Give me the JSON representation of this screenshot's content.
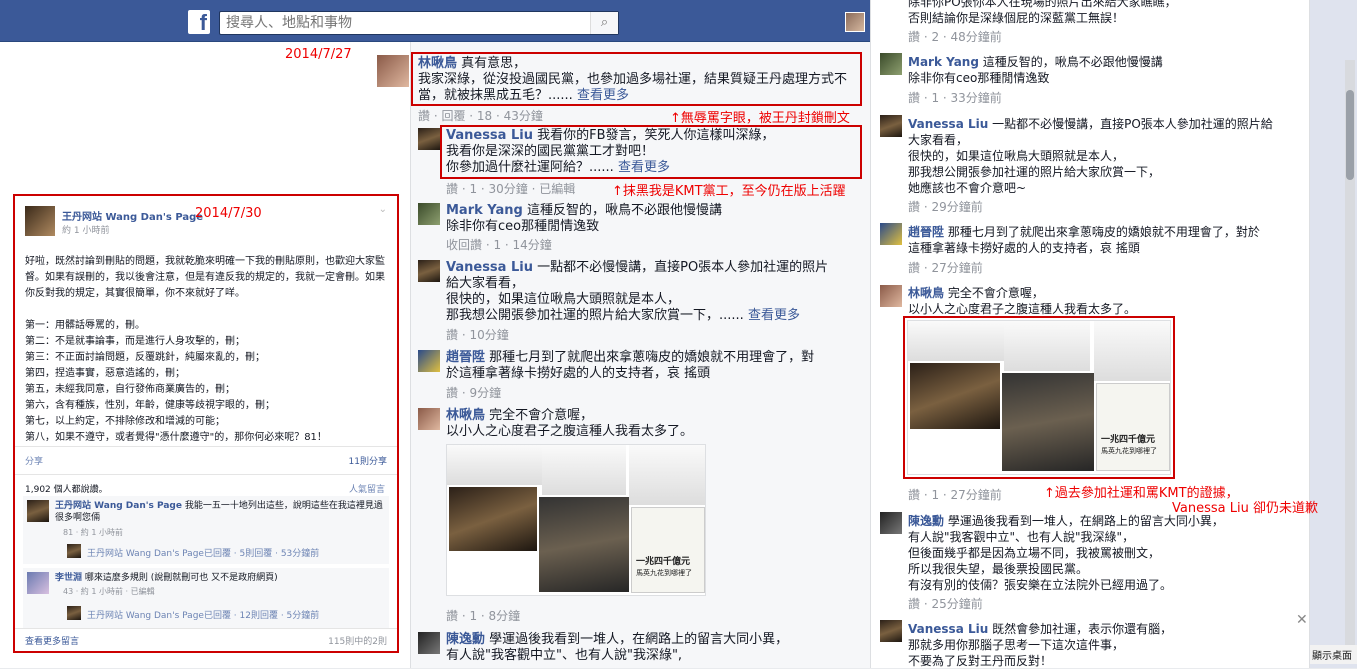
{
  "search": {
    "placeholder": "搜尋人、地點和事物"
  },
  "brand": {
    "logo": "f"
  },
  "dates": {
    "d1": "2014/7/27",
    "d2": "2014/7/30"
  },
  "wangdan_post": {
    "author": "王丹网站 Wang Dan's Page",
    "time": "約 1 小時前",
    "body": "好啦，既然討論到刪貼的問題，我就乾脆來明確一下我的刪貼原則，也歡迎大家監督。如果有誤刪的，我以後會注意，但是有違反我的規定的，我就一定會刪。如果你反對我的規定，其實很簡單，你不來就好了咩。\n\n第一：用髒話辱罵的，刪。\n第二：不是就事論事，而是進行人身攻擊的，刪；\n第三：不正面討論問題，反覆跳針，純屬來亂的，刪；\n第四，捏造事實，惡意造謠的，刪；\n第五，未經我同意，自行發佈商業廣告的，刪；\n第六，含有種族，性別，年齡，健康等歧視字眼的，刪；\n第七，以上約定，不排除修改和增減的可能；\n第八，如果不遵守，或者覺得\"憑什麼遵守\"的，那你何必來呢？81！",
    "share": "分享",
    "share_count": "11則分享",
    "likes": "1,902 個人都說讚。",
    "sort": "人氣留言",
    "comments": [
      {
        "name": "王丹网站 Wang Dan's Page",
        "text": "我能一五一十地列出這些，說明這些在我這裡見過很多啊您倆",
        "meta": "81 · 約 1 小時前",
        "reply": "王丹网站 Wang Dan's Page已回覆 · 5則回覆 · 53分鐘前"
      },
      {
        "name": "李世淵",
        "text": "哪來這麼多規則 (說刪就刪可也 又不是政府網頁)",
        "meta": "43 · 約 1 小時前 · 已編輯",
        "reply": "王丹网站 Wang Dan's Page已回覆 · 12則回覆 · 5分鐘前"
      }
    ],
    "more_comments": "查看更多留言",
    "count": "115則中的2則"
  },
  "middle": {
    "c1": {
      "name": "林啾鳥",
      "line1": "真有意思，",
      "line2": "我家深綠，從沒投過國民黨，也參加過多場社運，結果質疑王丹處理方式不",
      "line3": "當，就被抹黑成五毛？......",
      "more": "查看更多",
      "meta": "讚 · 回覆 · 18 · 43分鐘"
    },
    "anno1": "↑無辱罵字眼，被王丹封鎖刪文",
    "c2": {
      "name": "Vanessa Liu",
      "line1": "我看你的FB發言，笑死人你這樣叫深綠，",
      "line2": "我看你是深深的國民黨黨工才對吧！",
      "line3": "你參加過什麼社運阿給？......",
      "more": "查看更多",
      "meta": "讚 · 1 · 30分鐘 · 已編輯"
    },
    "anno2": "↑抹黑我是KMT黨工，至今仍在版上活躍",
    "c3": {
      "name": "Mark Yang",
      "line1": "這種反智的，啾鳥不必跟他慢慢講",
      "line2": "除非你有ceo那種閒情逸致",
      "meta": "收回讚 · 1 · 14分鐘"
    },
    "c4": {
      "name": "Vanessa Liu",
      "line1": "一點都不必慢慢講，直接PO張本人參加社運的照片",
      "line2": "給大家看看，",
      "line3": "很快的，如果這位啾鳥大頭照就是本人，",
      "line4": "那我想公開張參加社運的照片給大家欣賞一下，......",
      "more": "查看更多",
      "meta": "讚 · 10分鐘"
    },
    "c5": {
      "name": "趙晉陞",
      "line1": "那種七月到了就爬出來拿蔥嗨皮的嬌娘就不用理會了，對",
      "line2": "於這種拿著綠卡撈好處的人的支持者，哀 搖頭",
      "meta": "讚 · 9分鐘"
    },
    "c6": {
      "name": "林啾鳥",
      "line1": "完全不會介意喔，",
      "line2": "以小人之心度君子之腹這種人我看太多了。",
      "meta": "讚 · 1 · 8分鐘"
    },
    "c7": {
      "name": "陳逸勳",
      "line1": "學運過後我看到一堆人，在網路上的留言大同小異，",
      "line2": "有人說\"我客觀中立\"、也有人說\"我深綠\","
    }
  },
  "right": {
    "top1": "除非你PO張你本人在現場的照片出來給大家瞧瞧，",
    "top2": "否則結論你是深綠個屁的深藍黨工無誤！",
    "top_meta": "讚 · 2 · 48分鐘前",
    "r1": {
      "name": "Mark Yang",
      "line1": "這種反智的，啾鳥不必跟他慢慢講",
      "line2": "除非你有ceo那種閒情逸致",
      "meta": "讚 · 1 · 33分鐘前"
    },
    "r2": {
      "name": "Vanessa Liu",
      "line1": "一點都不必慢慢講，直接PO張本人參加社運的照片給",
      "line2": "大家看看，",
      "line3": "很快的，如果這位啾鳥大頭照就是本人，",
      "line4": "那我想公開張參加社運的照片給大家欣賞一下，",
      "line5": "她應該也不會介意吧~",
      "meta": "讚 · 29分鐘前"
    },
    "r3": {
      "name": "趙晉陞",
      "line1": "那種七月到了就爬出來拿蔥嗨皮的嬌娘就不用理會了，對於",
      "line2": "這種拿著綠卡撈好處的人的支持者，哀 搖頭",
      "meta": "讚 · 27分鐘前"
    },
    "r4": {
      "name": "林啾鳥",
      "line1": "完全不會介意喔，",
      "line2": "以小人之心度君子之腹這種人我看太多了。",
      "meta": "讚 · 1 · 27分鐘前"
    },
    "anno3a": "↑過去參加社運和罵KMT的證據，",
    "anno3b": "Vanessa Liu 卻仍未道歉",
    "r5": {
      "name": "陳逸勳",
      "line1": "學運過後我看到一堆人，在網路上的留言大同小異，",
      "line2": "有人說\"我客觀中立\"、也有人說\"我深綠\"，",
      "line3": "但後面幾乎都是因為立場不同，我被罵被刪文，",
      "line4": "所以我很失望，最後票投國民黨。",
      "line5": "有沒有別的伎倆？張安樂在立法院外已經用過了。",
      "meta": "讚 · 25分鐘前"
    },
    "r6": {
      "name": "Vanessa Liu",
      "line1": "既然會參加社運，表示你還有腦，",
      "line2": "那就多用你那腦子思考一下這次這件事，",
      "line3": "不要為了反對王丹而反對！"
    }
  },
  "poster_text": {
    "a": "一兆四千億元",
    "b": "馬英九花到哪裡了"
  },
  "desk": "顯示桌面",
  "colors": {
    "facebook_blue": "#3b5998",
    "annotation_red": "#e00000",
    "box_red": "#cc0000"
  }
}
